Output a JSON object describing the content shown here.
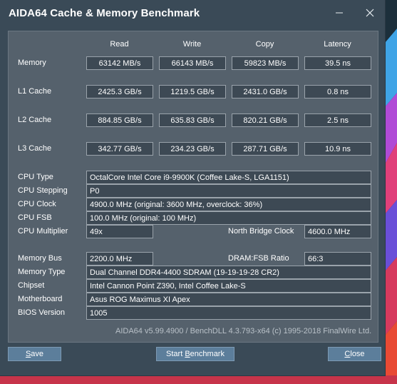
{
  "window": {
    "title": "AIDA64 Cache & Memory Benchmark"
  },
  "bench": {
    "headers": {
      "read": "Read",
      "write": "Write",
      "copy": "Copy",
      "latency": "Latency"
    },
    "rows": [
      {
        "label": "Memory",
        "read": "63142 MB/s",
        "write": "66143 MB/s",
        "copy": "59823 MB/s",
        "latency": "39.5 ns"
      },
      {
        "label": "L1 Cache",
        "read": "2425.3 GB/s",
        "write": "1219.5 GB/s",
        "copy": "2431.0 GB/s",
        "latency": "0.8 ns"
      },
      {
        "label": "L2 Cache",
        "read": "884.85 GB/s",
        "write": "635.83 GB/s",
        "copy": "820.21 GB/s",
        "latency": "2.5 ns"
      },
      {
        "label": "L3 Cache",
        "read": "342.77 GB/s",
        "write": "234.23 GB/s",
        "copy": "287.71 GB/s",
        "latency": "10.9 ns"
      }
    ]
  },
  "cpu": {
    "type_label": "CPU Type",
    "type": "OctalCore Intel Core i9-9900K  (Coffee Lake-S, LGA1151)",
    "stepping_label": "CPU Stepping",
    "stepping": "P0",
    "clock_label": "CPU Clock",
    "clock": "4900.0 MHz  (original: 3600 MHz, overclock: 36%)",
    "fsb_label": "CPU FSB",
    "fsb": "100.0 MHz  (original: 100 MHz)",
    "multiplier_label": "CPU Multiplier",
    "multiplier": "49x",
    "nb_clock_label": "North Bridge Clock",
    "nb_clock": "4600.0 MHz"
  },
  "memory": {
    "bus_label": "Memory Bus",
    "bus": "2200.0 MHz",
    "ratio_label": "DRAM:FSB Ratio",
    "ratio": "66:3",
    "type_label": "Memory Type",
    "type": "Dual Channel DDR4-4400 SDRAM  (19-19-19-28 CR2)",
    "chipset_label": "Chipset",
    "chipset": "Intel Cannon Point Z390, Intel Coffee Lake-S",
    "motherboard_label": "Motherboard",
    "motherboard": "Asus ROG Maximus XI Apex",
    "bios_label": "BIOS Version",
    "bios": "1005"
  },
  "footer": {
    "text": "AIDA64 v5.99.4900 / BenchDLL 4.3.793-x64  (c) 1995-2018 FinalWire Ltd."
  },
  "buttons": {
    "save_first": "S",
    "save_rest": "ave",
    "start_pre": "Start ",
    "start_u": "B",
    "start_rest": "enchmark",
    "close_first": "C",
    "close_rest": "lose"
  },
  "colors": {
    "window_bg": "#3a4a57",
    "panel_bg": "#55616c",
    "button_bg": "#5c7e9b",
    "box_bg": "#3d4954"
  }
}
